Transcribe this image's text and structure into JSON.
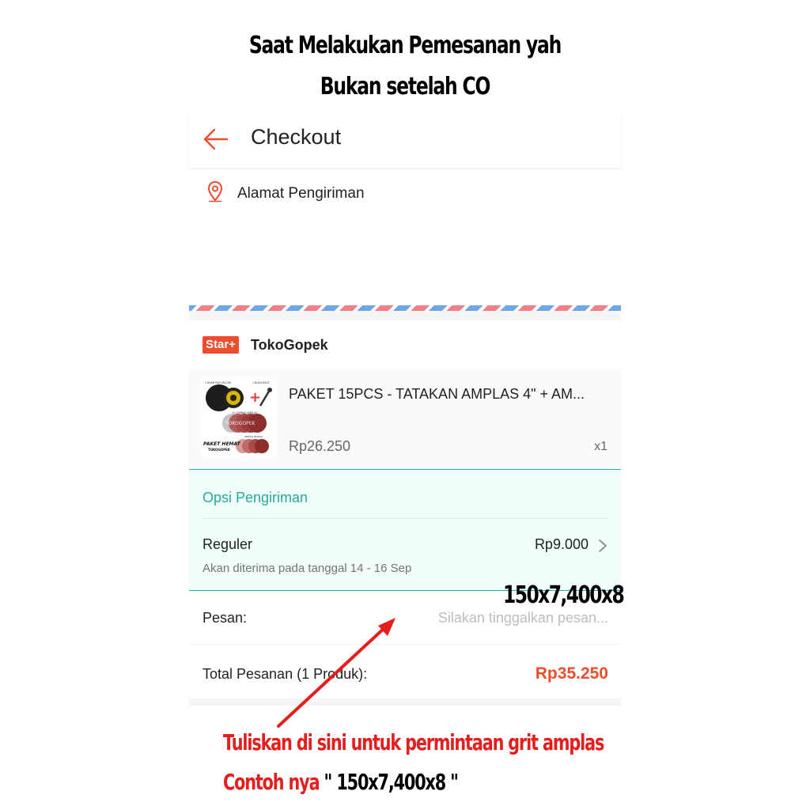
{
  "captions": {
    "line1": "Saat Melakukan Pemesanan yah",
    "line2": "Bukan setelah CO"
  },
  "header": {
    "title": "Checkout",
    "back_icon": "arrow-left-icon"
  },
  "address": {
    "label": "Alamat Pengiriman",
    "icon": "location-pin-icon"
  },
  "shop": {
    "badge": "Star+",
    "name": "TokoGopek"
  },
  "product": {
    "name": "PAKET 15PCS - TATAKAN AMPLAS 4\" + AM...",
    "price": "Rp26.250",
    "qty": "x1",
    "image_labels": {
      "velcro": "1 BUAH PAD VELCRO",
      "bolt": "1 BUAH BAUT",
      "sheets": "10 LEMBAR AMPLAS",
      "watermark": "TOKOGOPEK",
      "bonus": "KERTAS BONUS",
      "brand_line1": "PAKET HEMAT",
      "brand_line2": "TOKOGOPEK"
    }
  },
  "shipping": {
    "title": "Opsi Pengiriman",
    "method": "Reguler",
    "price": "Rp9.000",
    "eta": "Akan diterima pada tanggal 14 - 16 Sep"
  },
  "message": {
    "label": "Pesan:",
    "placeholder": "Silakan tinggalkan pesan..."
  },
  "total": {
    "label": "Total Pesanan (1 Produk):",
    "value": "Rp35.250"
  },
  "annotation": {
    "example_value": "150x7,400x8",
    "note_line1": "Tuliskan di sini untuk permintaan grit amplas",
    "note_line2_prefix": "Contoh nya",
    "note_line2_example": " \" 150x7,400x8 \""
  },
  "colors": {
    "brand": "#ee4d2d",
    "teal": "#26aa99",
    "annotation_red": "#e51d1d"
  }
}
